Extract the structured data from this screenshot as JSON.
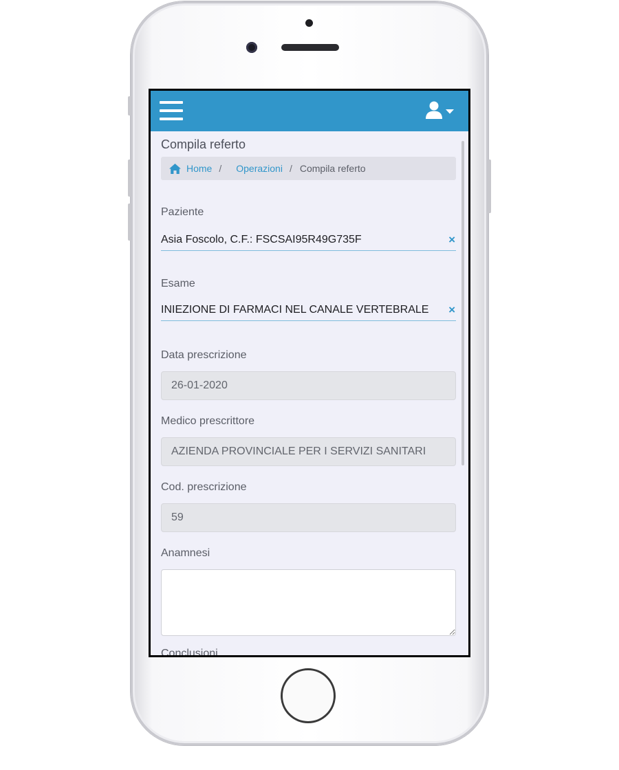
{
  "header": {
    "menu_icon": "hamburger-icon",
    "user_icon": "user-icon",
    "caret_icon": "caret-down-icon"
  },
  "page": {
    "title": "Compila referto"
  },
  "breadcrumb": {
    "home_icon": "home-icon",
    "items": [
      "Home",
      "Operazioni",
      "Compila referto"
    ],
    "separator": "/"
  },
  "form": {
    "paziente": {
      "label": "Paziente",
      "value": "Asia Foscolo, C.F.: FSCSAI95R49G735F",
      "clear": "×"
    },
    "esame": {
      "label": "Esame",
      "value": "INIEZIONE DI FARMACI NEL CANALE VERTEBRALE",
      "clear": "×"
    },
    "data_prescrizione": {
      "label": "Data prescrizione",
      "value": "26-01-2020"
    },
    "medico_prescrittore": {
      "label": "Medico prescrittore",
      "value": "AZIENDA PROVINCIALE PER I SERVIZI SANITARI"
    },
    "cod_prescrizione": {
      "label": "Cod. prescrizione",
      "value": "59"
    },
    "anamnesi": {
      "label": "Anamnesi",
      "value": ""
    },
    "next_label": "Conclusioni"
  },
  "colors": {
    "navbar": "#3196ca",
    "link": "#3196ca",
    "background": "#f0f0f9"
  }
}
